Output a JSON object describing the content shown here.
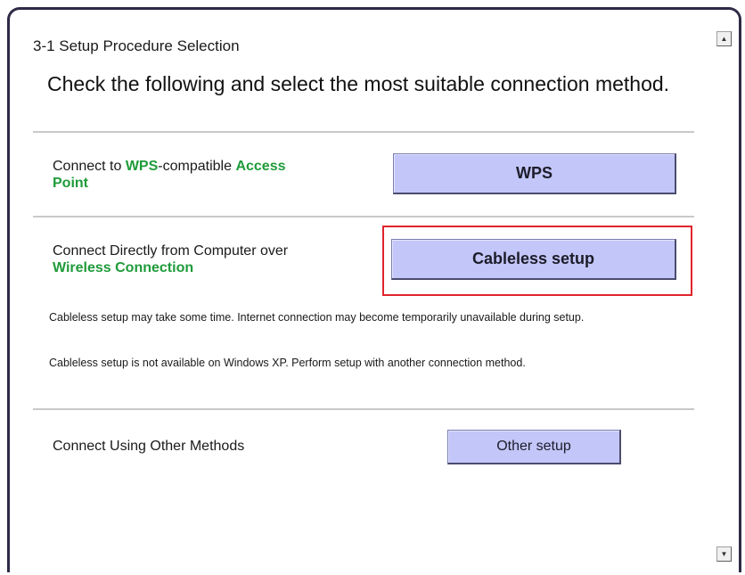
{
  "header": {
    "step_title": "3-1 Setup Procedure Selection",
    "instruction": "Check the following and select the most suitable connection method."
  },
  "options": {
    "wps": {
      "label_prefix": "Connect to ",
      "label_wps": "WPS",
      "label_mid": "-compatible ",
      "label_access": "Access",
      "label_point": "Point",
      "button": "WPS"
    },
    "cableless": {
      "label_line1": "Connect Directly from Computer over",
      "label_line2": "Wireless Connection",
      "button": "Cableless setup",
      "note1": "Cableless setup may take some time. Internet connection may become temporarily unavailable during setup.",
      "note2": "Cableless setup is not available on Windows XP. Perform setup with another connection method."
    },
    "other": {
      "label": "Connect Using Other Methods",
      "button": "Other setup"
    }
  },
  "scrollbar": {
    "up_icon": "scroll-up-arrow-icon",
    "down_icon": "scroll-down-arrow-icon"
  },
  "colors": {
    "highlight_text": "#1f9b3a",
    "button_fill": "#c3c6f8",
    "selection_box": "#e0242c",
    "frame_border": "#2f2a47"
  }
}
